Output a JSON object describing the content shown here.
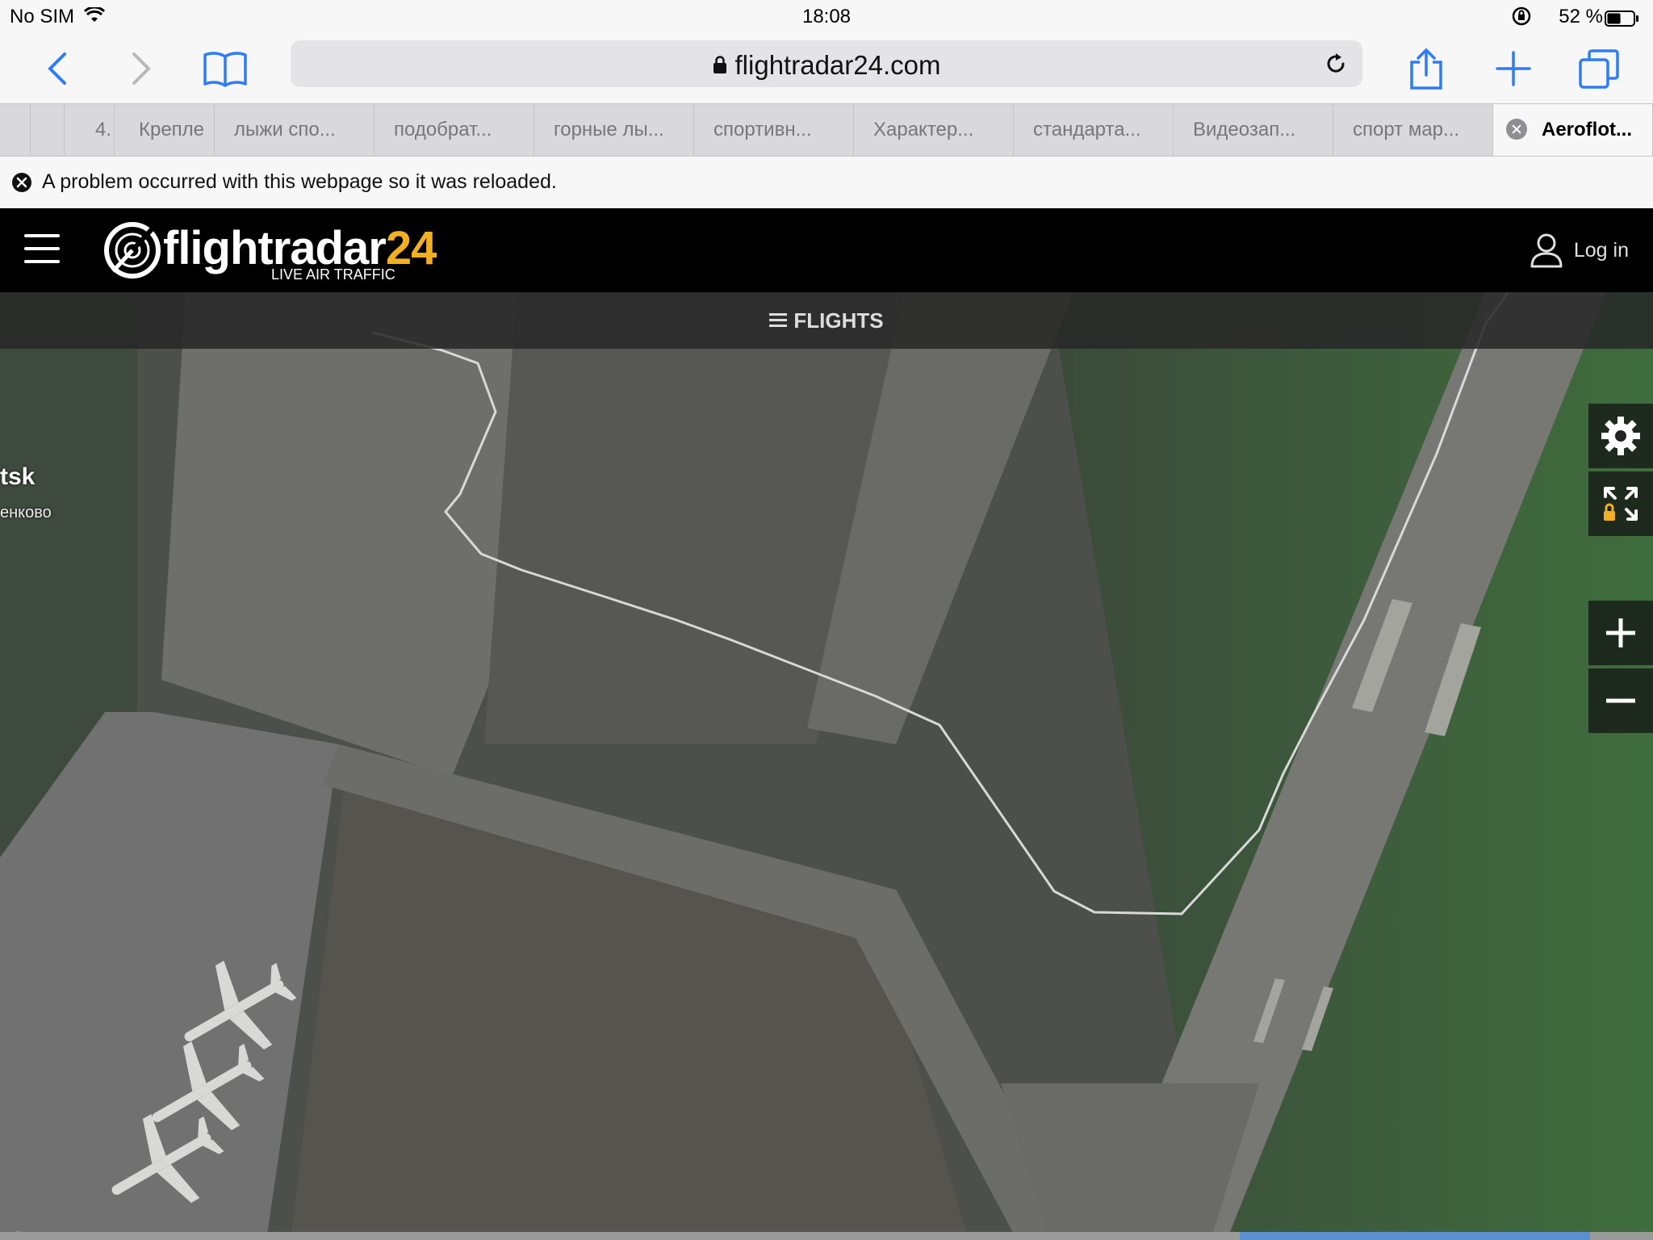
{
  "status_bar": {
    "carrier": "No SIM",
    "time": "18:08",
    "battery_percent": "52 %",
    "battery_level": 0.52
  },
  "browser": {
    "url": "flightradar24.com",
    "tabs": [
      {
        "label": ""
      },
      {
        "label": "4."
      },
      {
        "label": "Крепле"
      },
      {
        "label": "лыжи спо..."
      },
      {
        "label": "подобрат..."
      },
      {
        "label": "горные лы..."
      },
      {
        "label": "спортивн..."
      },
      {
        "label": "Характер..."
      },
      {
        "label": "стандарта..."
      },
      {
        "label": "Видеозап..."
      },
      {
        "label": "спорт мар..."
      },
      {
        "label": "Aeroflot..."
      }
    ],
    "active_tab_index": 11,
    "notice": "A problem occurred with this webpage so it was reloaded."
  },
  "fr24": {
    "logo_word": "flightradar",
    "logo_num": "24",
    "tagline": "LIVE AIR TRAFFIC",
    "login_label": "Log in",
    "flights_label": "FLIGHTS",
    "brand_color": "#f2b020"
  },
  "map": {
    "labels": [
      "tsk",
      "енково"
    ]
  }
}
